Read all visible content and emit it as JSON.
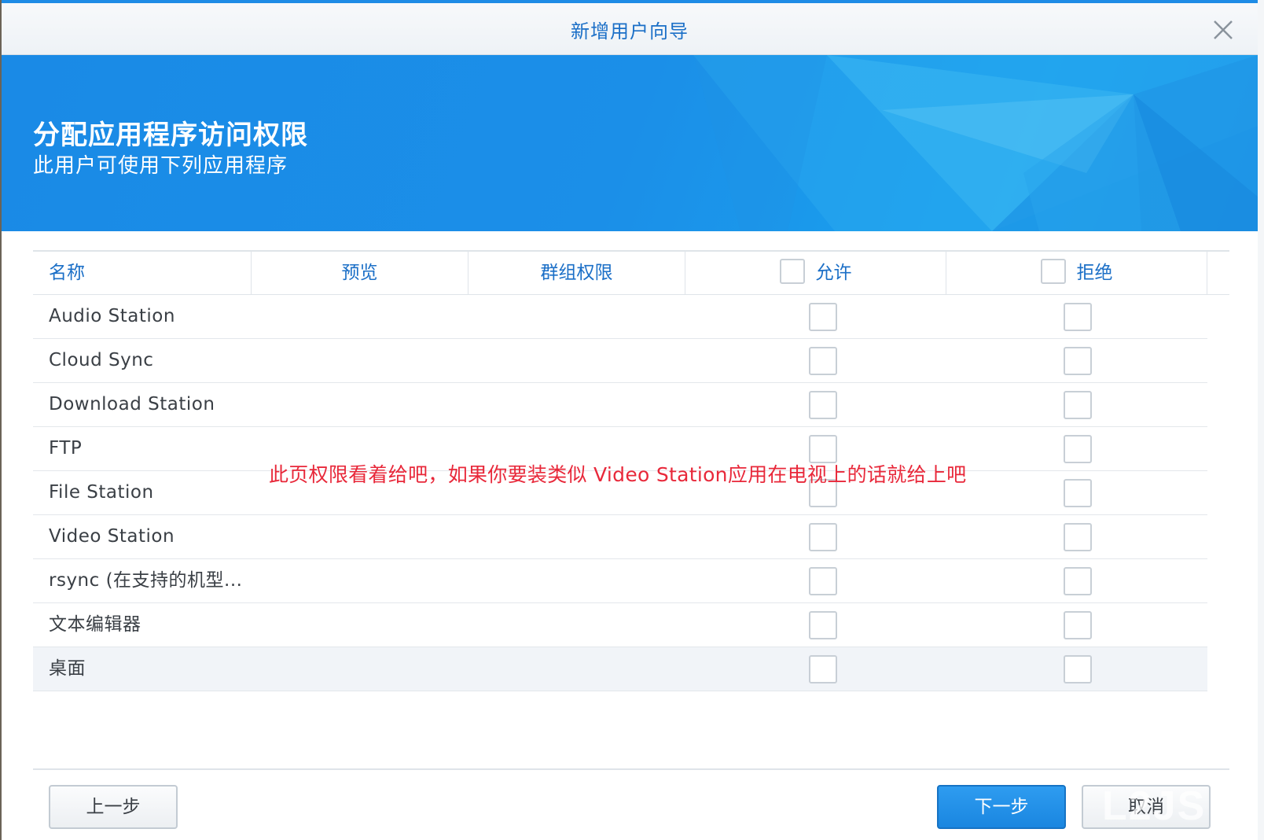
{
  "dialog": {
    "title": "新增用户向导",
    "close_icon": "close-icon"
  },
  "banner": {
    "heading": "分配应用程序访问权限",
    "subheading": "此用户可使用下列应用程序"
  },
  "table": {
    "columns": {
      "name": "名称",
      "preview": "预览",
      "group_permission": "群组权限",
      "allow": "允许",
      "deny": "拒绝"
    },
    "rows": [
      {
        "name": "Audio Station",
        "allow": false,
        "deny": false
      },
      {
        "name": "Cloud Sync",
        "allow": false,
        "deny": false
      },
      {
        "name": "Download Station",
        "allow": false,
        "deny": false
      },
      {
        "name": "FTP",
        "allow": false,
        "deny": false
      },
      {
        "name": "File Station",
        "allow": false,
        "deny": false
      },
      {
        "name": "Video Station",
        "allow": false,
        "deny": false
      },
      {
        "name": "rsync (在支持的机型...",
        "allow": false,
        "deny": false
      },
      {
        "name": "文本编辑器",
        "allow": false,
        "deny": false
      },
      {
        "name": "桌面",
        "allow": false,
        "deny": false
      }
    ]
  },
  "annotation": "此页权限看着给吧，如果你要装类似 Video Station应用在电视上的话就给上吧",
  "footer": {
    "prev_label": "上一步",
    "next_label": "下一步",
    "cancel_label": "取消"
  },
  "watermark": "L2JS",
  "colors": {
    "accent": "#1a86e0",
    "title_text": "#1b6fc7",
    "annotation": "#e8283a"
  }
}
